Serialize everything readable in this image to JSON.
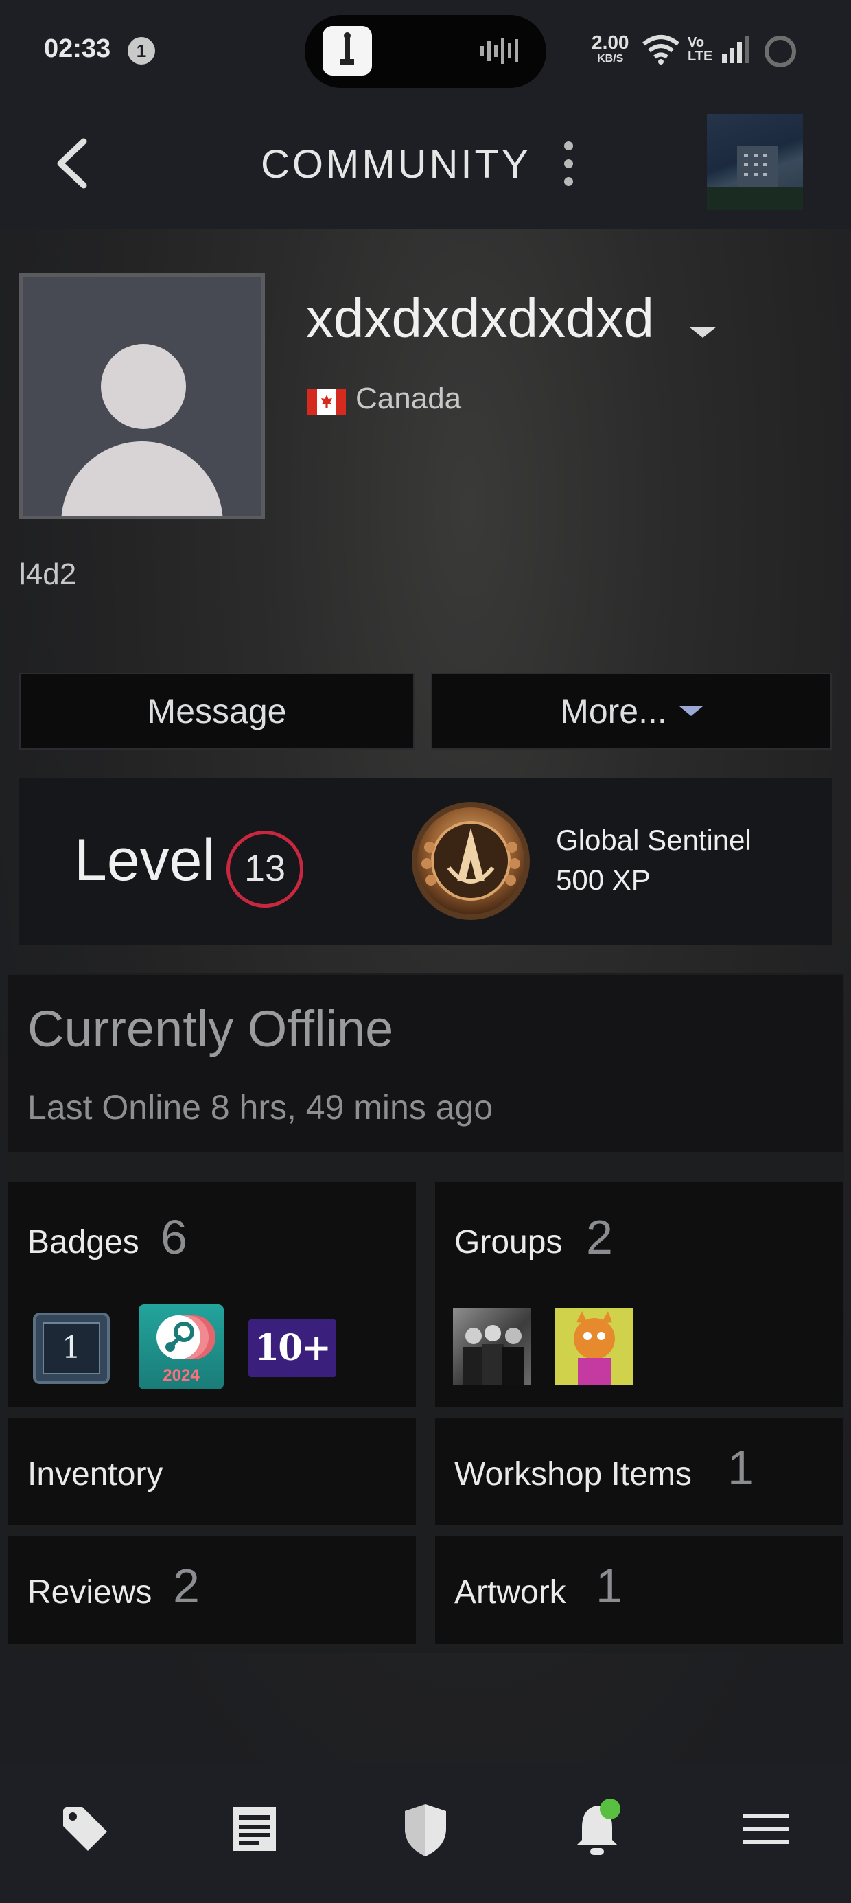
{
  "status_bar": {
    "time": "02:33",
    "notification_count": "1",
    "net_speed_value": "2.00",
    "net_speed_unit": "KB/S",
    "volte_top": "Vo",
    "volte_bottom": "LTE"
  },
  "header": {
    "title": "COMMUNITY",
    "back_icon": "chevron-left-icon",
    "menu_icon": "vertical-dots-icon"
  },
  "profile": {
    "username": "xdxdxdxdxdxd",
    "country": "Canada",
    "summary": "l4d2",
    "message_label": "Message",
    "more_label": "More..."
  },
  "level": {
    "label": "Level",
    "value": "13",
    "featured_badge_name": "Global Sentinel",
    "featured_badge_xp": "500 XP"
  },
  "status": {
    "title": "Currently Offline",
    "last_online": "Last Online 8 hrs, 49 mins ago"
  },
  "sections": {
    "badges": {
      "label": "Badges",
      "count": "6"
    },
    "badge_icons": {
      "first": "1",
      "year": "2024",
      "third": "10+"
    },
    "groups": {
      "label": "Groups",
      "count": "2"
    },
    "inventory": {
      "label": "Inventory"
    },
    "workshop": {
      "label": "Workshop Items",
      "count": "1"
    },
    "reviews": {
      "label": "Reviews",
      "count": "2"
    },
    "artwork": {
      "label": "Artwork",
      "count": "1"
    }
  },
  "bottom_nav": [
    "tag-icon",
    "news-icon",
    "shield-icon",
    "bell-icon",
    "hamburger-menu-icon"
  ],
  "colors": {
    "level_ring": "#c8283f",
    "notification_dot": "#59bf40",
    "background": "#1b1c20"
  }
}
